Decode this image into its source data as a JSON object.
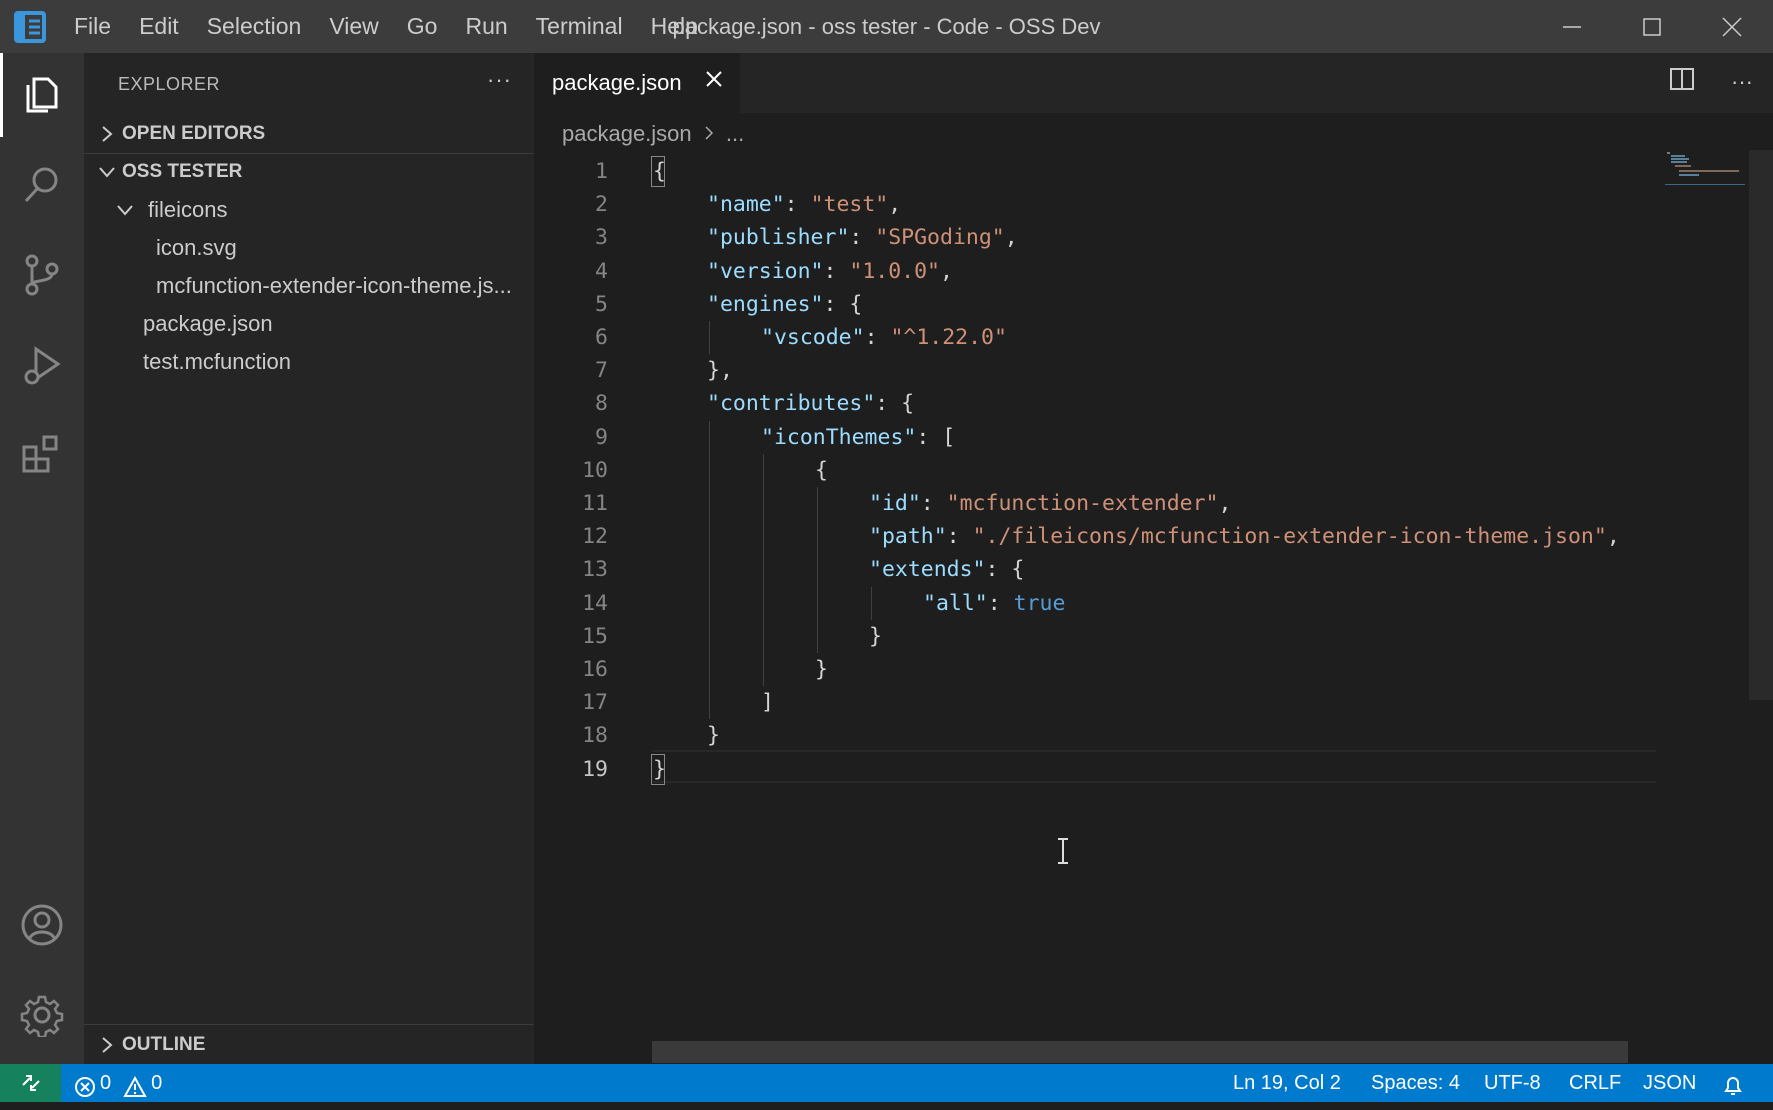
{
  "window": {
    "title": "package.json - oss tester - Code - OSS Dev"
  },
  "menu": [
    "File",
    "Edit",
    "Selection",
    "View",
    "Go",
    "Run",
    "Terminal",
    "Help"
  ],
  "activity_bar": {
    "top": [
      "files-icon",
      "search-icon",
      "source-control-icon",
      "run-debug-icon",
      "extensions-icon"
    ],
    "bottom": [
      "account-icon",
      "settings-gear-icon"
    ]
  },
  "sidebar": {
    "title": "EXPLORER",
    "more": "···",
    "open_editors": "OPEN EDITORS",
    "folder": "OSS TESTER",
    "tree": [
      {
        "label": "fileicons",
        "kind": "folder",
        "depth": 1
      },
      {
        "label": "icon.svg",
        "kind": "file",
        "depth": 2
      },
      {
        "label": "mcfunction-extender-icon-theme.js...",
        "kind": "file",
        "depth": 2
      },
      {
        "label": "package.json",
        "kind": "file",
        "depth": 1
      },
      {
        "label": "test.mcfunction",
        "kind": "file",
        "depth": 1
      }
    ],
    "outline": "OUTLINE"
  },
  "editor": {
    "tab_label": "package.json",
    "breadcrumb": {
      "file": "package.json",
      "rest": "..."
    },
    "active_line": 19,
    "lines": [
      {
        "n": "1",
        "indent": 0,
        "tokens": [
          [
            "{",
            "pun"
          ]
        ]
      },
      {
        "n": "2",
        "indent": 1,
        "tokens": [
          [
            "\"name\"",
            "key"
          ],
          [
            ": ",
            "pun"
          ],
          [
            "\"test\"",
            "str"
          ],
          [
            ",",
            "pun"
          ]
        ]
      },
      {
        "n": "3",
        "indent": 1,
        "tokens": [
          [
            "\"publisher\"",
            "key"
          ],
          [
            ": ",
            "pun"
          ],
          [
            "\"SPGoding\"",
            "str"
          ],
          [
            ",",
            "pun"
          ]
        ]
      },
      {
        "n": "4",
        "indent": 1,
        "tokens": [
          [
            "\"version\"",
            "key"
          ],
          [
            ": ",
            "pun"
          ],
          [
            "\"1.0.0\"",
            "str"
          ],
          [
            ",",
            "pun"
          ]
        ]
      },
      {
        "n": "5",
        "indent": 1,
        "tokens": [
          [
            "\"engines\"",
            "key"
          ],
          [
            ": {",
            "pun"
          ]
        ]
      },
      {
        "n": "6",
        "indent": 2,
        "tokens": [
          [
            "\"vscode\"",
            "key"
          ],
          [
            ": ",
            "pun"
          ],
          [
            "\"^1.22.0\"",
            "str"
          ]
        ]
      },
      {
        "n": "7",
        "indent": 1,
        "tokens": [
          [
            "},",
            "pun"
          ]
        ]
      },
      {
        "n": "8",
        "indent": 1,
        "tokens": [
          [
            "\"contributes\"",
            "key"
          ],
          [
            ": {",
            "pun"
          ]
        ]
      },
      {
        "n": "9",
        "indent": 2,
        "tokens": [
          [
            "\"iconThemes\"",
            "key"
          ],
          [
            ": [",
            "pun"
          ]
        ]
      },
      {
        "n": "10",
        "indent": 3,
        "tokens": [
          [
            "{",
            "pun"
          ]
        ]
      },
      {
        "n": "11",
        "indent": 4,
        "tokens": [
          [
            "\"id\"",
            "key"
          ],
          [
            ": ",
            "pun"
          ],
          [
            "\"mcfunction-extender\"",
            "str"
          ],
          [
            ",",
            "pun"
          ]
        ]
      },
      {
        "n": "12",
        "indent": 4,
        "tokens": [
          [
            "\"path\"",
            "key"
          ],
          [
            ": ",
            "pun"
          ],
          [
            "\"./fileicons/mcfunction-extender-icon-theme.json\"",
            "str"
          ],
          [
            ",",
            "pun"
          ]
        ]
      },
      {
        "n": "13",
        "indent": 4,
        "tokens": [
          [
            "\"extends\"",
            "key"
          ],
          [
            ": {",
            "pun"
          ]
        ]
      },
      {
        "n": "14",
        "indent": 5,
        "tokens": [
          [
            "\"all\"",
            "key"
          ],
          [
            ": ",
            "pun"
          ],
          [
            "true",
            "bool"
          ]
        ]
      },
      {
        "n": "15",
        "indent": 4,
        "tokens": [
          [
            "}",
            "pun"
          ]
        ]
      },
      {
        "n": "16",
        "indent": 3,
        "tokens": [
          [
            "}",
            "pun"
          ]
        ]
      },
      {
        "n": "17",
        "indent": 2,
        "tokens": [
          [
            "]",
            "pun"
          ]
        ]
      },
      {
        "n": "18",
        "indent": 1,
        "tokens": [
          [
            "}",
            "pun"
          ]
        ]
      },
      {
        "n": "19",
        "indent": 0,
        "tokens": [
          [
            "}",
            "pun"
          ]
        ]
      }
    ]
  },
  "status_bar": {
    "errors": "0",
    "warnings": "0",
    "position": "Ln 19, Col 2",
    "spaces": "Spaces: 4",
    "encoding": "UTF-8",
    "eol": "CRLF",
    "language": "JSON"
  },
  "colors": {
    "status_bar": "#007acc",
    "remote": "#16825d",
    "key": "#9cdcfe",
    "string": "#ce9178",
    "boolean": "#569cd6"
  }
}
